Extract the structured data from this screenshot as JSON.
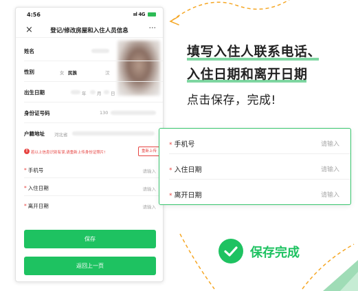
{
  "status_bar": {
    "time": "4:56",
    "signal": "ııl 4G"
  },
  "nav": {
    "close_icon": "×",
    "title": "登记/修改房屋和入住人员信息",
    "more_icon": "···"
  },
  "info": {
    "name_label": "姓名",
    "gender_label": "性别",
    "gender_value": "女",
    "ethnicity_label": "民族",
    "ethnicity_value": "汉",
    "birth_label": "出生日期",
    "birth_year_suffix": "年",
    "birth_month_suffix": "月",
    "birth_day_suffix": "日",
    "id_label": "身份证号码",
    "id_value_prefix": "130",
    "hukou_label": "户籍地址",
    "hukou_value_prefix": "河北省"
  },
  "warning": {
    "icon": "!",
    "text": "若以上信息识别有误,请重新上传身份证照片!",
    "reupload_label": "重新上传"
  },
  "form": {
    "phone_label": "手机号",
    "checkin_label": "入住日期",
    "checkout_label": "离开日期",
    "placeholder": "请输入",
    "required_mark": "*"
  },
  "buttons": {
    "save": "保存",
    "back": "返回上一页"
  },
  "headline": {
    "line1": "填写入住人联系电话、",
    "line2": "入住日期和离开日期",
    "line3": "点击保存，完成!"
  },
  "done": {
    "label": "保存完成"
  },
  "colors": {
    "accent_green": "#1ec261",
    "highlight_green": "#7ed6a1",
    "warning_red": "#e64340",
    "deco_orange": "#f5a623"
  }
}
